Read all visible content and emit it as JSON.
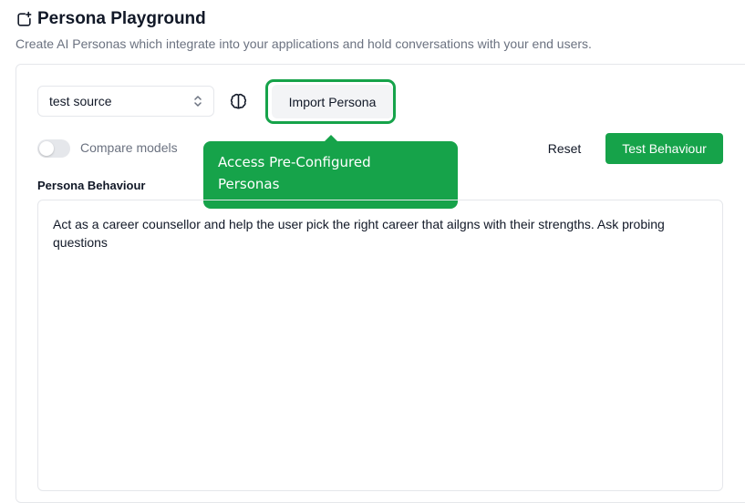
{
  "header": {
    "title": "Persona Playground",
    "subtitle": "Create AI Personas which integrate into your applications and hold conversations with your end users."
  },
  "controls": {
    "source_select_value": "test source",
    "import_label": "Import Persona",
    "compare_label": "Compare models",
    "compare_enabled": false,
    "reset_label": "Reset",
    "test_label": "Test Behaviour"
  },
  "tooltip": {
    "line1": "Access Pre-Configured",
    "line2": "Personas"
  },
  "behaviour": {
    "label": "Persona Behaviour",
    "text": "Act as a career counsellor and help the user pick the right career that ailgns with their strengths. Ask probing questions"
  },
  "colors": {
    "accent": "#16a34a"
  },
  "icons": {
    "title_icon": "sparkle-square-icon",
    "select_icon": "chevron-up-down-icon",
    "brain_icon": "brain-icon"
  }
}
